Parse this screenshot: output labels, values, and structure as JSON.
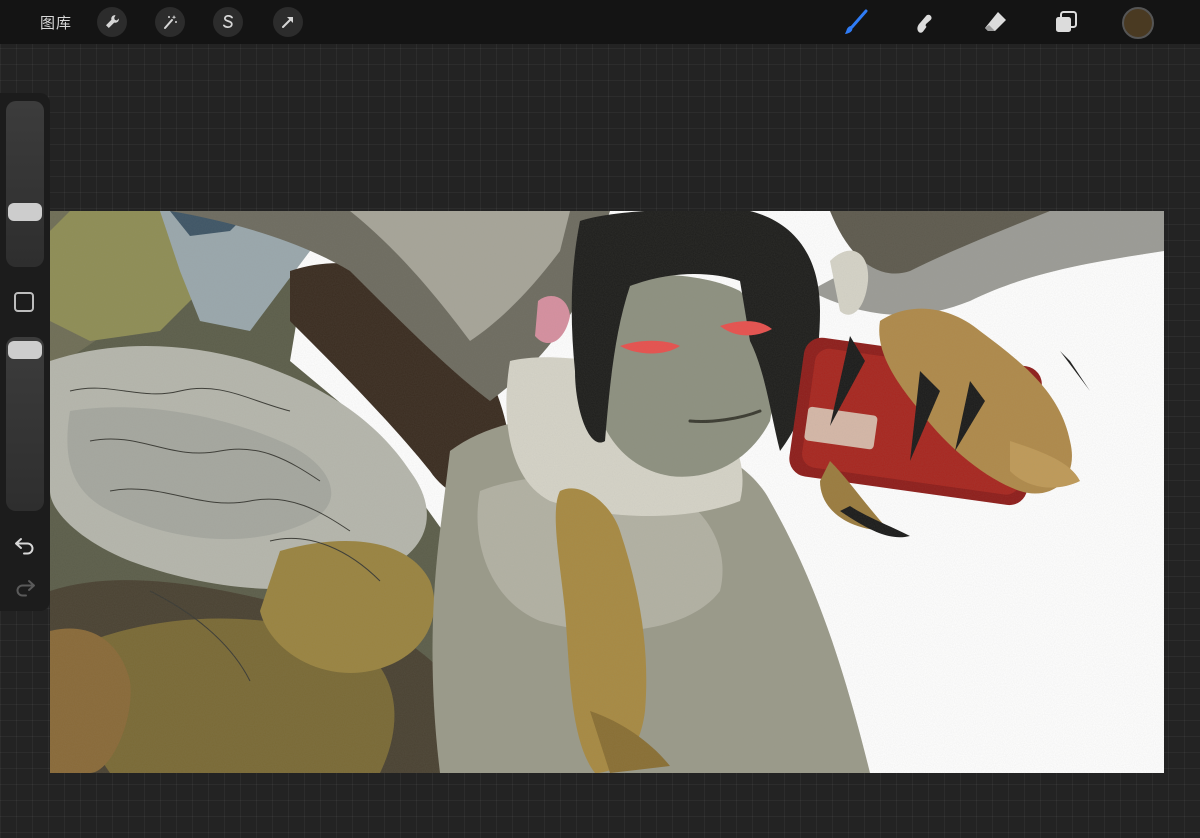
{
  "topbar": {
    "gallery_label": "图库",
    "left_tools": [
      "wrench-icon",
      "magic-wand-icon",
      "selection-s-icon",
      "transform-arrow-icon"
    ],
    "right_tools": [
      "brush-icon",
      "smudge-icon",
      "eraser-icon",
      "layers-icon"
    ],
    "active_tool": "brush",
    "accent_color": "#2f7cf6",
    "current_color": "#4a3a22"
  },
  "sidebar": {
    "brush_size_level": 0.3,
    "opacity_level": 1.0,
    "undo_icon": "undo-icon",
    "redo_icon": "redo-icon"
  },
  "canvas": {
    "content": "painting",
    "background_color": "#ffffff"
  }
}
